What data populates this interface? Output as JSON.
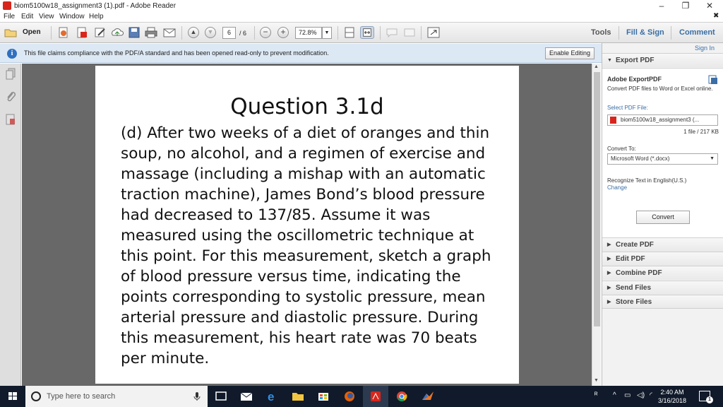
{
  "window": {
    "title": "biom5100w18_assignment3 (1).pdf - Adobe Reader",
    "minimize": "–",
    "restore": "❐",
    "close": "✕",
    "close_doc": "✖"
  },
  "menu": [
    "File",
    "Edit",
    "View",
    "Window",
    "Help"
  ],
  "toolbar": {
    "open_label": "Open",
    "page_current": "6",
    "page_total": "/ 6",
    "zoom_out": "−",
    "zoom_in": "+",
    "zoom": "72.8%",
    "tools": "Tools",
    "fill_sign": "Fill & Sign",
    "comment": "Comment"
  },
  "infobar": {
    "icon": "i",
    "message": "This file claims compliance with the PDF/A standard and has been opened read-only to prevent modification.",
    "enable_editing": "Enable Editing"
  },
  "document": {
    "title": "Question 3.1d",
    "body": "(d) After two weeks of a diet of oranges and thin soup, no alcohol, and a regimen of exercise and massage (including a mishap with an automatic traction machine), James Bond’s blood pressure had decreased to 137/85. Assume it was measured using the oscillometric technique at this point. For this measurement, sketch a graph of blood pressure versus time, indicating the points corresponding to systolic pressure, mean arterial pressure and diastolic pressure. During this measurement, his heart rate was 70 beats per minute."
  },
  "rightpane": {
    "sign_in": "Sign In",
    "export_head": "Export PDF",
    "export_title": "Adobe ExportPDF",
    "export_desc": "Convert PDF files to Word or Excel online.",
    "select_label": "Select PDF File:",
    "selected_file": "biom5100w18_assignment3 (...",
    "file_info": "1 file / 217 KB",
    "convert_to_label": "Convert To:",
    "convert_to_value": "Microsoft Word (*.docx)",
    "recognize_text": "Recognize Text in English(U.S.)",
    "change": "Change",
    "convert_button": "Convert",
    "sections": [
      "Create PDF",
      "Edit PDF",
      "Combine PDF",
      "Send Files",
      "Store Files"
    ]
  },
  "taskbar": {
    "search_placeholder": "Type here to search",
    "time": "2:40 AM",
    "date": "3/16/2018",
    "notification_count": "1"
  },
  "icons": {
    "app": "adobe-reader-icon",
    "info": "info-icon",
    "start": "windows-start-icon"
  },
  "colors": {
    "accent_blue": "#3a6ea5",
    "info_bar": "#dce8f4",
    "doc_background": "#686868",
    "taskbar": "#101a2a",
    "adobe_red": "#d8261c"
  }
}
